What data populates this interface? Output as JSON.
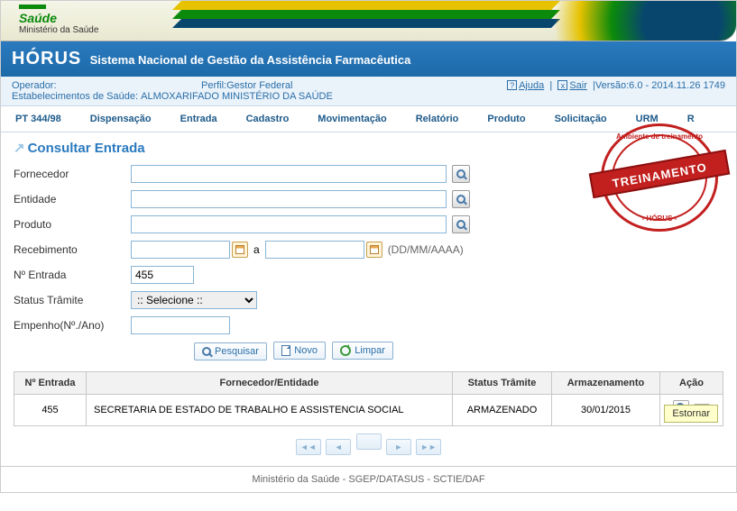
{
  "header": {
    "saude": "Saúde",
    "ministerio": "Ministério da Saúde"
  },
  "system": {
    "name": "HÓRUS",
    "tagline": "Sistema Nacional de Gestão da Assistência Farmacêutica"
  },
  "info": {
    "operador_label": "Operador:",
    "perfil_label": "Perfil:",
    "perfil_value": "Gestor Federal",
    "ajuda": "Ajuda",
    "sair": "Sair",
    "versao": "Versão:6.0 - 2014.11.26 1749",
    "estab_label": "Estabelecimentos de Saúde:",
    "estab_value": "ALMOXARIFADO MINISTÉRIO DA SAÚDE"
  },
  "menu": [
    "PT 344/98",
    "Dispensação",
    "Entrada",
    "Cadastro",
    "Movimentação",
    "Relatório",
    "Produto",
    "Solicitação",
    "URM",
    "R"
  ],
  "page_title": "Consultar Entrada",
  "stamp": {
    "top": "Ambiente de treinamento",
    "band": "TREINAMENTO",
    "bottom": "- HÓRUS -"
  },
  "form": {
    "fornecedor_label": "Fornecedor",
    "fornecedor_value": "",
    "entidade_label": "Entidade",
    "entidade_value": "",
    "produto_label": "Produto",
    "produto_value": "",
    "recebimento_label": "Recebimento",
    "rec_from": "",
    "rec_to": "",
    "rec_sep": "a",
    "rec_hint": "(DD/MM/AAAA)",
    "nentrada_label": "Nº Entrada",
    "nentrada_value": "455",
    "status_label": "Status Trâmite",
    "status_value": ":: Selecione ::",
    "empenho_label": "Empenho(Nº./Ano)",
    "empenho_value": ""
  },
  "buttons": {
    "pesquisar": "Pesquisar",
    "novo": "Novo",
    "limpar": "Limpar"
  },
  "table": {
    "headers": [
      "Nº Entrada",
      "Fornecedor/Entidade",
      "Status Trâmite",
      "Armazenamento",
      "Ação"
    ],
    "rows": [
      {
        "num": "455",
        "forn": "SECRETARIA DE ESTADO DE TRABALHO E ASSISTENCIA SOCIAL",
        "status": "ARMAZENADO",
        "arm": "30/01/2015"
      }
    ]
  },
  "pager": [
    "◄◄",
    "◄",
    "",
    "►",
    "►►"
  ],
  "tooltip": "Estornar",
  "footer": "Ministério da Saúde - SGEP/DATASUS - SCTIE/DAF"
}
